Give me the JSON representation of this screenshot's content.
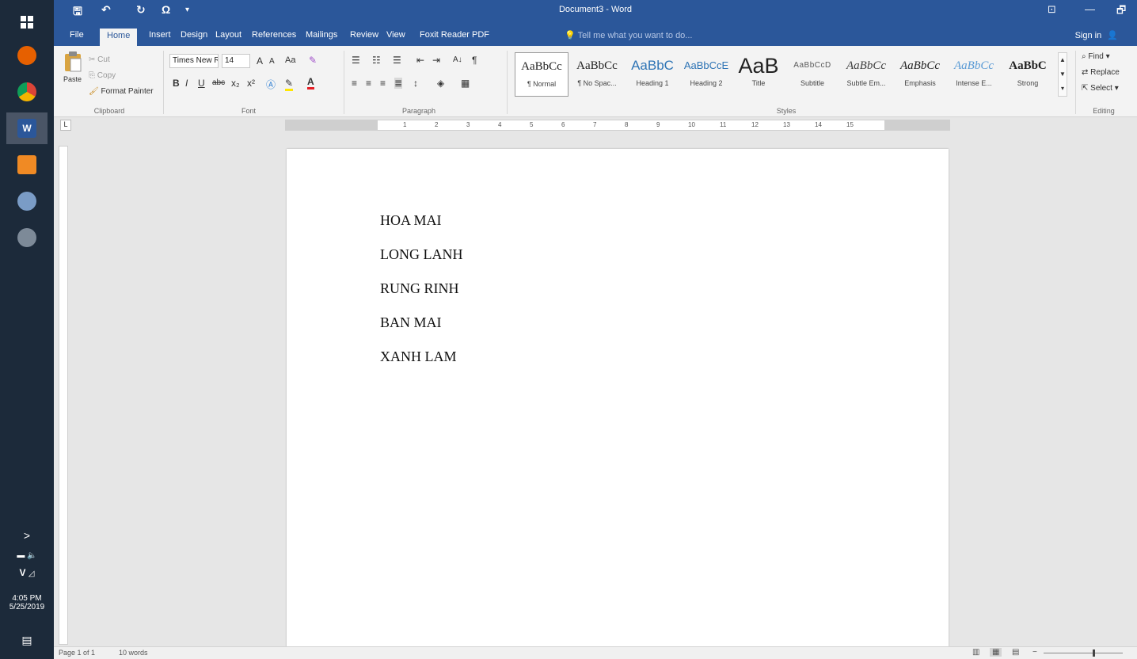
{
  "taskbar": {
    "clock_time": "4:05 PM",
    "clock_date": "5/25/2019",
    "expand_glyph": ">",
    "tray_v": "V"
  },
  "titlebar": {
    "title": "Document3 - Word",
    "qat_save": "🖫",
    "qat_undo": "↶",
    "qat_redo": "↻",
    "qat_symbol": "Ω",
    "qat_more": "▾",
    "minimize": "—",
    "restore": "🗗",
    "ribbon_display": "⊡"
  },
  "tabs": {
    "items": [
      "File",
      "Home",
      "Insert",
      "Design",
      "Layout",
      "References",
      "Mailings",
      "Review",
      "View",
      "Foxit Reader PDF"
    ],
    "tell_me": "Tell me what you want to do...",
    "sign_in": "Sign in"
  },
  "clipboard": {
    "paste": "Paste",
    "cut": "Cut",
    "copy": "Copy",
    "format_painter": "Format Painter",
    "label": "Clipboard"
  },
  "font": {
    "font_name": "Times New Ro",
    "font_size": "14",
    "label": "Font",
    "grow": "A",
    "shrink": "A",
    "change_case": "Aa",
    "bold": "B",
    "italic": "I",
    "underline": "U",
    "strike": "abc",
    "subscript": "x₂",
    "superscript": "x²",
    "font_color": "A"
  },
  "paragraph": {
    "label": "Paragraph",
    "sort": "A↓",
    "pilcrow": "¶"
  },
  "styles": {
    "label": "Styles",
    "items": [
      {
        "sample": "AaBbCc",
        "name": "¶ Normal"
      },
      {
        "sample": "AaBbCc",
        "name": "¶ No Spac..."
      },
      {
        "sample": "AaBbC",
        "name": "Heading 1"
      },
      {
        "sample": "AaBbCcE",
        "name": "Heading 2"
      },
      {
        "sample": "AaB",
        "name": "Title"
      },
      {
        "sample": "AaBbCcD",
        "name": "Subtitle"
      },
      {
        "sample": "AaBbCc",
        "name": "Subtle Em..."
      },
      {
        "sample": "AaBbCc",
        "name": "Emphasis"
      },
      {
        "sample": "AaBbCc",
        "name": "Intense E..."
      },
      {
        "sample": "AaBbC",
        "name": "Strong"
      }
    ]
  },
  "editing": {
    "find": "Find",
    "replace": "Replace",
    "select": "Select",
    "label": "Editing"
  },
  "ruler": {
    "tab_selector": "L",
    "numbers": [
      "1",
      "2",
      "3",
      "4",
      "5",
      "6",
      "7",
      "8",
      "9",
      "10",
      "11",
      "12",
      "13",
      "14",
      "15"
    ]
  },
  "document": {
    "lines": [
      "HOA MAI",
      "LONG LANH",
      "RUNG RINH",
      "BAN MAI",
      "XANH LAM"
    ]
  },
  "status": {
    "page": "Page 1 of 1",
    "words": "10 words"
  },
  "colors": {
    "word_blue": "#2b579a",
    "ribbon_bg": "#f3f3f3",
    "taskbar_bg": "#1c2a3a"
  }
}
